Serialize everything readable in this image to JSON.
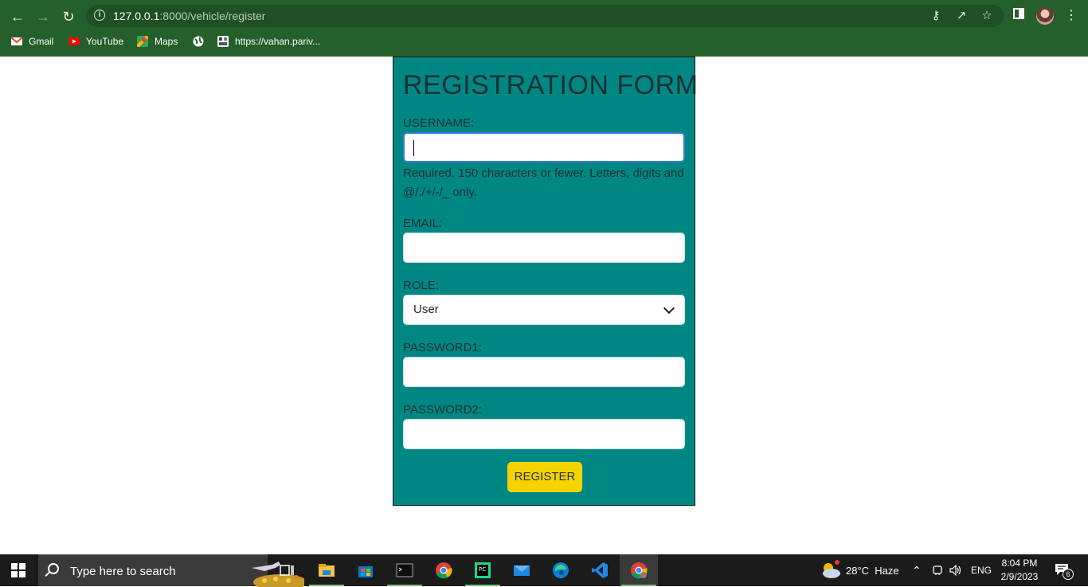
{
  "browser": {
    "url_host": "127.0.0.1",
    "url_path": ":8000/vehicle/register",
    "bookmarks": [
      "Gmail",
      "YouTube",
      "Maps",
      "https://vahan.pariv..."
    ]
  },
  "form": {
    "title": "REGISTRATION FORM",
    "username_label": "USERNAME:",
    "username_value": "",
    "username_help": "Required. 150 characters or fewer. Letters, digits and @/./+/-/_ only.",
    "email_label": "EMAIL:",
    "email_value": "",
    "role_label": "ROLE:",
    "role_selected": "User",
    "password1_label": "PASSWORD1:",
    "password2_label": "PASSWORD2:",
    "submit_label": "REGISTER"
  },
  "taskbar": {
    "search_placeholder": "Type here to search",
    "weather": "28°C  Haze",
    "language": "ENG",
    "time": "8:04 PM",
    "date": "2/9/2023",
    "notification_count": "6"
  },
  "colors": {
    "chrome": "#255f2b",
    "card": "#008784",
    "button": "#f5d300"
  }
}
